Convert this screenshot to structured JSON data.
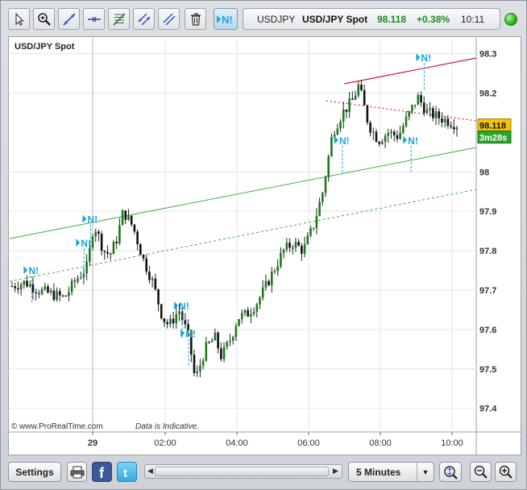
{
  "toolbar": {
    "tools": [
      {
        "name": "pointer-tool-button",
        "icon": "arrow-pointer-icon"
      },
      {
        "name": "zoom-tool-button",
        "icon": "magnifier-plus-icon"
      },
      {
        "name": "trendline-tool-button",
        "icon": "trendline-icon"
      },
      {
        "name": "horizontal-line-tool-button",
        "icon": "horizontal-line-icon"
      },
      {
        "name": "fibonacci-tool-button",
        "icon": "fibonacci-icon"
      },
      {
        "name": "channel-tool-button",
        "icon": "channel-icon"
      },
      {
        "name": "parallel-lines-tool-button",
        "icon": "parallel-lines-icon"
      },
      {
        "name": "delete-tool-button",
        "icon": "trash-icon"
      },
      {
        "name": "news-marker-button",
        "icon": "news-marker-icon",
        "label": "N!"
      }
    ]
  },
  "instrument": {
    "symbol": "USDJPY",
    "title": "USD/JPY Spot",
    "price": "98.118",
    "change": "+0.38%",
    "time": "10:11",
    "status_color": "#22b81a"
  },
  "chart": {
    "title": "USD/JPY Spot",
    "copyright": "©  www.ProRealTime.com",
    "disclaimer": "Data is Indicative.",
    "price_label": "98.118",
    "countdown_label": "3m28s",
    "news_label": "N!",
    "colors": {
      "candle_up": "#1a7a1a",
      "candle_down": "#111111",
      "candle_wick": "#222222",
      "trendline_green": "#3fae3f",
      "trendline_red": "#d01a34",
      "news_marker": "#1ba6d6",
      "price_label_bg": "#f5c400",
      "countdown_bg": "#2da52d"
    }
  },
  "chart_data": {
    "type": "candlestick",
    "title": "USD/JPY Spot",
    "ylim": [
      97.34,
      98.34
    ],
    "y_ticks": [
      "98.3",
      "98.2",
      "98",
      "97.9",
      "97.8",
      "97.7",
      "97.6",
      "97.5",
      "97.4"
    ],
    "y_tick_values": [
      98.3,
      98.2,
      98.0,
      97.9,
      97.8,
      97.7,
      97.6,
      97.5,
      97.4
    ],
    "x_ticks": [
      "29",
      "02:00",
      "04:00",
      "06:00",
      "08:00",
      "10:00"
    ],
    "interval": "5 Minutes",
    "last_price": 98.118,
    "price_path": [
      [
        0,
        97.71
      ],
      [
        0.04,
        97.72
      ],
      [
        0.08,
        97.7
      ],
      [
        0.12,
        97.69
      ],
      [
        0.16,
        97.68
      ],
      [
        0.19,
        97.72
      ],
      [
        0.21,
        97.74
      ],
      [
        0.23,
        97.76
      ],
      [
        0.25,
        97.87
      ],
      [
        0.28,
        97.8
      ],
      [
        0.3,
        97.79
      ],
      [
        0.32,
        97.83
      ],
      [
        0.34,
        97.9
      ],
      [
        0.37,
        97.86
      ],
      [
        0.4,
        97.78
      ],
      [
        0.43,
        97.72
      ],
      [
        0.46,
        97.63
      ],
      [
        0.48,
        97.61
      ],
      [
        0.51,
        97.65
      ],
      [
        0.54,
        97.58
      ],
      [
        0.56,
        97.47
      ],
      [
        0.59,
        97.55
      ],
      [
        0.62,
        97.58
      ],
      [
        0.64,
        97.53
      ],
      [
        0.67,
        97.58
      ],
      [
        0.69,
        97.63
      ],
      [
        0.72,
        97.64
      ],
      [
        0.75,
        97.67
      ],
      [
        0.77,
        97.7
      ],
      [
        0.8,
        97.75
      ],
      [
        0.83,
        97.8
      ],
      [
        0.86,
        97.82
      ],
      [
        0.89,
        97.8
      ],
      [
        0.92,
        97.86
      ],
      [
        0.95,
        97.95
      ],
      [
        0.98,
        98.1
      ],
      [
        1.01,
        98.15
      ],
      [
        1.04,
        98.18
      ],
      [
        1.06,
        98.22
      ],
      [
        1.09,
        98.12
      ],
      [
        1.12,
        98.08
      ],
      [
        1.15,
        98.1
      ],
      [
        1.18,
        98.09
      ],
      [
        1.21,
        98.14
      ],
      [
        1.24,
        98.19
      ],
      [
        1.27,
        98.15
      ],
      [
        1.3,
        98.14
      ],
      [
        1.33,
        98.13
      ],
      [
        1.36,
        98.12
      ]
    ],
    "news_markers": [
      {
        "t": 0.06,
        "y": 97.72
      },
      {
        "t": 0.22,
        "y": 97.79
      },
      {
        "t": 0.24,
        "y": 97.85
      },
      {
        "t": 0.52,
        "y": 97.63
      },
      {
        "t": 0.54,
        "y": 97.56
      },
      {
        "t": 1.01,
        "y": 98.05
      },
      {
        "t": 1.22,
        "y": 98.05
      },
      {
        "t": 1.26,
        "y": 98.26
      }
    ]
  },
  "bottom": {
    "settings_label": "Settings",
    "interval_label": "5 Minutes"
  }
}
